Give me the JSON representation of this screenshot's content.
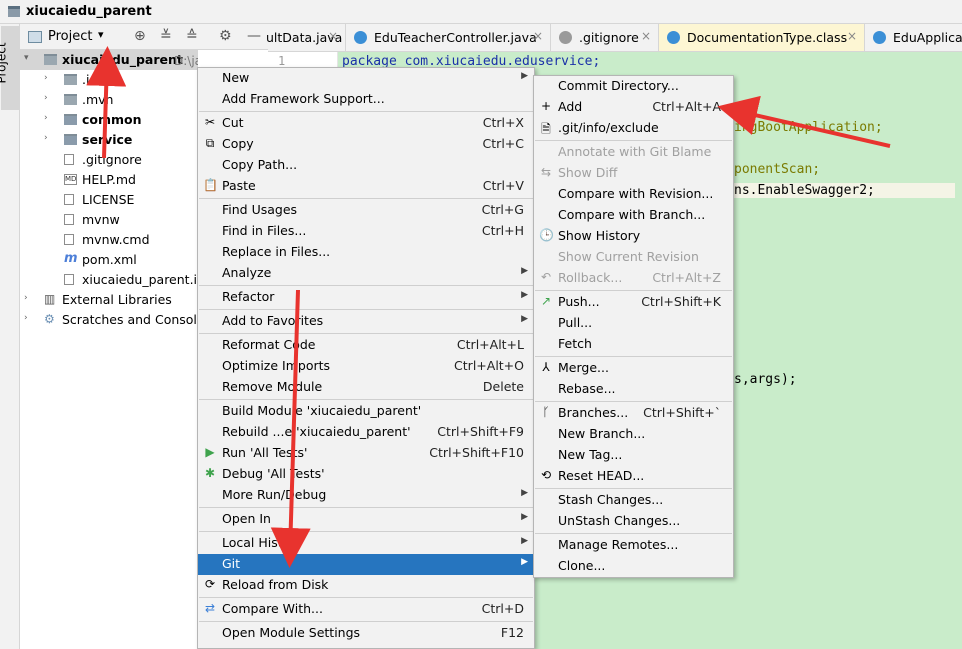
{
  "window": {
    "title": "xiucaiedu_parent"
  },
  "left_strip": {
    "label": "Project"
  },
  "project_panel": {
    "label": "Project",
    "dropdown": "▾",
    "tree": [
      {
        "label": "xiucaiedu_parent",
        "suffix": "D:\\java学习\\dem",
        "level": 0,
        "arrow": "▾",
        "icon": "folder-icon",
        "bold": true
      },
      {
        "label": ".ide",
        "level": 1,
        "arrow": "›",
        "icon": "folder-icon"
      },
      {
        "label": ".mvn",
        "level": 1,
        "arrow": "›",
        "icon": "folder-icon"
      },
      {
        "label": "common",
        "level": 1,
        "arrow": "›",
        "icon": "module-folder-icon",
        "bold": true
      },
      {
        "label": "service",
        "level": 1,
        "arrow": "›",
        "icon": "module-folder-icon",
        "bold": true
      },
      {
        "label": ".gitignore",
        "level": 1,
        "icon": "file-icon"
      },
      {
        "label": "HELP.md",
        "level": 1,
        "icon": "markdown-icon"
      },
      {
        "label": "LICENSE",
        "level": 1,
        "icon": "file-icon"
      },
      {
        "label": "mvnw",
        "level": 1,
        "icon": "file-icon"
      },
      {
        "label": "mvnw.cmd",
        "level": 1,
        "icon": "file-icon"
      },
      {
        "label": "pom.xml",
        "level": 1,
        "icon": "maven-icon"
      },
      {
        "label": "xiucaiedu_parent.iml",
        "level": 1,
        "icon": "file-icon"
      },
      {
        "label": "External Libraries",
        "level": 0,
        "arrow": "›",
        "icon": "library-icon"
      },
      {
        "label": "Scratches and Consoles",
        "level": 0,
        "arrow": "›",
        "icon": "scratch-icon"
      }
    ]
  },
  "editor_tabs": [
    {
      "label": "ultData.java",
      "icon_color": "#3b8fd6"
    },
    {
      "label": "EduTeacherController.java",
      "icon_color": "#3b8fd6"
    },
    {
      "label": ".gitignore",
      "icon_color": "#9a9a9a"
    },
    {
      "label": "DocumentationType.class",
      "icon_color": "#3b8fd6",
      "active": true
    },
    {
      "label": "EduApplicat",
      "icon_color": "#3b8fd6"
    }
  ],
  "editor": {
    "line_number": "1",
    "lines": [
      {
        "text": "package com.xiucaiedu.eduservice;",
        "color": "#1a30a8"
      },
      {
        "text": ";",
        "color": "#000"
      },
      {
        "text": "ingBootApplication;",
        "color": "#7a7a00"
      },
      {
        "text": "ponentScan;",
        "color": "#7a7a00"
      },
      {
        "text": "ns.EnableSwagger2;",
        "color": "#000"
      },
      {
        "text": "s,args);",
        "color": "#000"
      }
    ]
  },
  "context_menu": {
    "items": [
      {
        "label": "New",
        "submenu": true
      },
      {
        "label": "Add Framework Support..."
      },
      {
        "sep": true
      },
      {
        "label": "Cut",
        "shortcut": "Ctrl+X",
        "icon": "✂"
      },
      {
        "label": "Copy",
        "shortcut": "Ctrl+C",
        "icon": "⧉"
      },
      {
        "label": "Copy Path..."
      },
      {
        "label": "Paste",
        "shortcut": "Ctrl+V",
        "icon": "📋"
      },
      {
        "sep": true
      },
      {
        "label": "Find Usages",
        "shortcut": "Ctrl+G"
      },
      {
        "label": "Find in Files...",
        "shortcut": "Ctrl+H"
      },
      {
        "label": "Replace in Files..."
      },
      {
        "label": "Analyze",
        "submenu": true
      },
      {
        "sep": true
      },
      {
        "label": "Refactor",
        "submenu": true
      },
      {
        "sep": true
      },
      {
        "label": "Add to Favorites",
        "submenu": true
      },
      {
        "sep": true
      },
      {
        "label": "Reformat Code",
        "shortcut": "Ctrl+Alt+L"
      },
      {
        "label": "Optimize Imports",
        "shortcut": "Ctrl+Alt+O"
      },
      {
        "label": "Remove Module",
        "shortcut": "Delete"
      },
      {
        "sep": true
      },
      {
        "label": "Build Module 'xiucaiedu_parent'"
      },
      {
        "label": "Rebuild ...e 'xiucaiedu_parent'",
        "shortcut": "Ctrl+Shift+F9"
      },
      {
        "label": "Run 'All Tests'",
        "shortcut": "Ctrl+Shift+F10",
        "icon": "▶",
        "icon_color": "#3fa34d"
      },
      {
        "label": "Debug 'All Tests'",
        "icon": "✱",
        "icon_color": "#3fa34d"
      },
      {
        "label": "More Run/Debug",
        "submenu": true
      },
      {
        "sep": true
      },
      {
        "label": "Open In",
        "submenu": true
      },
      {
        "sep": true
      },
      {
        "label": "Local History",
        "submenu": true
      },
      {
        "label": "Git",
        "submenu": true,
        "selected": true
      },
      {
        "label": "Reload from Disk",
        "icon": "⟳"
      },
      {
        "sep": true
      },
      {
        "label": "Compare With...",
        "shortcut": "Ctrl+D",
        "icon": "⇄",
        "icon_color": "#3b7fd6"
      },
      {
        "sep": true
      },
      {
        "label": "Open Module Settings",
        "shortcut": "F12"
      }
    ]
  },
  "git_submenu": {
    "items": [
      {
        "label": "Commit Directory..."
      },
      {
        "label": "Add",
        "shortcut": "Ctrl+Alt+A",
        "icon": "+"
      },
      {
        "label": ".git/info/exclude",
        "icon": "🗎"
      },
      {
        "sep": true
      },
      {
        "label": "Annotate with Git Blame",
        "disabled": true
      },
      {
        "label": "Show Diff",
        "disabled": true,
        "icon": "⇆"
      },
      {
        "label": "Compare with Revision..."
      },
      {
        "label": "Compare with Branch..."
      },
      {
        "label": "Show History",
        "icon": "🕒"
      },
      {
        "label": "Show Current Revision",
        "disabled": true
      },
      {
        "label": "Rollback...",
        "shortcut": "Ctrl+Alt+Z",
        "disabled": true,
        "icon": "↶"
      },
      {
        "sep": true
      },
      {
        "label": "Push...",
        "shortcut": "Ctrl+Shift+K",
        "icon": "↗",
        "icon_color": "#3fa34d"
      },
      {
        "label": "Pull..."
      },
      {
        "label": "Fetch"
      },
      {
        "sep": true
      },
      {
        "label": "Merge...",
        "icon": "⅄"
      },
      {
        "label": "Rebase..."
      },
      {
        "sep": true
      },
      {
        "label": "Branches...",
        "shortcut": "Ctrl+Shift+`",
        "icon": "ᚴ"
      },
      {
        "label": "New Branch..."
      },
      {
        "label": "New Tag..."
      },
      {
        "label": "Reset HEAD...",
        "icon": "⟲"
      },
      {
        "sep": true
      },
      {
        "label": "Stash Changes..."
      },
      {
        "label": "UnStash Changes..."
      },
      {
        "sep": true
      },
      {
        "label": "Manage Remotes..."
      },
      {
        "label": "Clone..."
      }
    ]
  }
}
